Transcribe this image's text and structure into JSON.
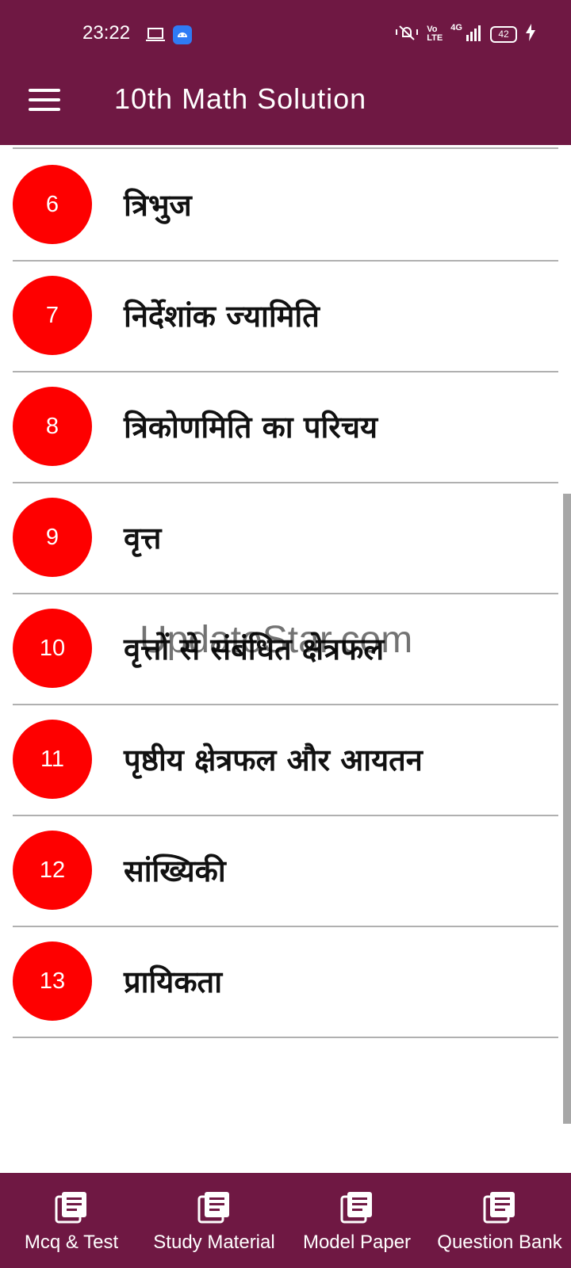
{
  "status_bar": {
    "time": "23:22",
    "network": "4G",
    "volte_top": "Vo",
    "volte_bottom": "LTE",
    "battery": "42"
  },
  "app_bar": {
    "title": "10th Math Solution"
  },
  "chapters": [
    {
      "number": "6",
      "title": "त्रिभुज"
    },
    {
      "number": "7",
      "title": "निर्देशांक ज्यामिति"
    },
    {
      "number": "8",
      "title": "त्रिकोणमिति का परिचय"
    },
    {
      "number": "9",
      "title": "वृत्त"
    },
    {
      "number": "10",
      "title": "वृत्तों से संबंधित क्षेत्रफल"
    },
    {
      "number": "11",
      "title": "पृष्ठीय क्षेत्रफल और आयतन"
    },
    {
      "number": "12",
      "title": "सांख्यिकी"
    },
    {
      "number": "13",
      "title": "प्रायिकता"
    }
  ],
  "watermark": "UpdateStar.com",
  "bottom_nav": [
    {
      "label": "Mcq & Test",
      "icon": "book-icon"
    },
    {
      "label": "Study Material",
      "icon": "book-icon"
    },
    {
      "label": "Model Paper",
      "icon": "book-icon"
    },
    {
      "label": "Question Bank",
      "icon": "book-icon"
    }
  ],
  "colors": {
    "app_bar": "#6f1843",
    "badge": "#fe0000",
    "divider": "#b0b0b0"
  }
}
